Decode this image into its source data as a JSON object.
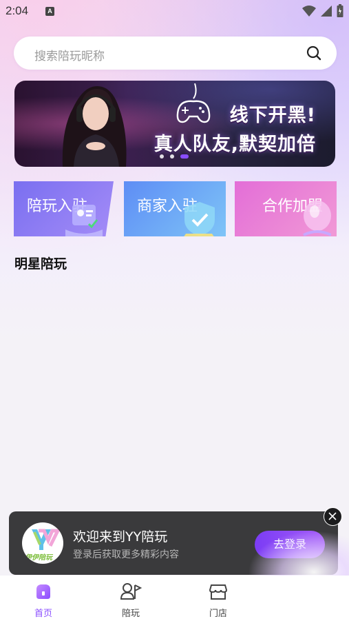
{
  "status_bar": {
    "time": "2:04",
    "notification_badge": "A"
  },
  "search": {
    "placeholder": "搜索陪玩昵称"
  },
  "banner": {
    "line1": "线下开黑!",
    "line2": "真人队友,默契加倍",
    "active_dot": 3,
    "dot_count": 3
  },
  "entry_cards": [
    {
      "label": "陪玩入驻"
    },
    {
      "label": "商家入驻"
    },
    {
      "label": "合作加盟"
    }
  ],
  "section": {
    "title": "明星陪玩"
  },
  "login_toast": {
    "title": "欢迎来到YY陪玩",
    "subtitle": "登录后获取更多精彩内容",
    "button": "去登录",
    "logo_text": "伊伊陪玩"
  },
  "bottom_nav": {
    "items": [
      {
        "label": "首页",
        "icon": "home-icon",
        "active": true
      },
      {
        "label": "陪玩",
        "icon": "companion-icon",
        "active": false
      },
      {
        "label": "门店",
        "icon": "store-icon",
        "active": false
      }
    ]
  },
  "colors": {
    "accent": "#8a4dff",
    "toast_bg": "#3a3a3c"
  }
}
